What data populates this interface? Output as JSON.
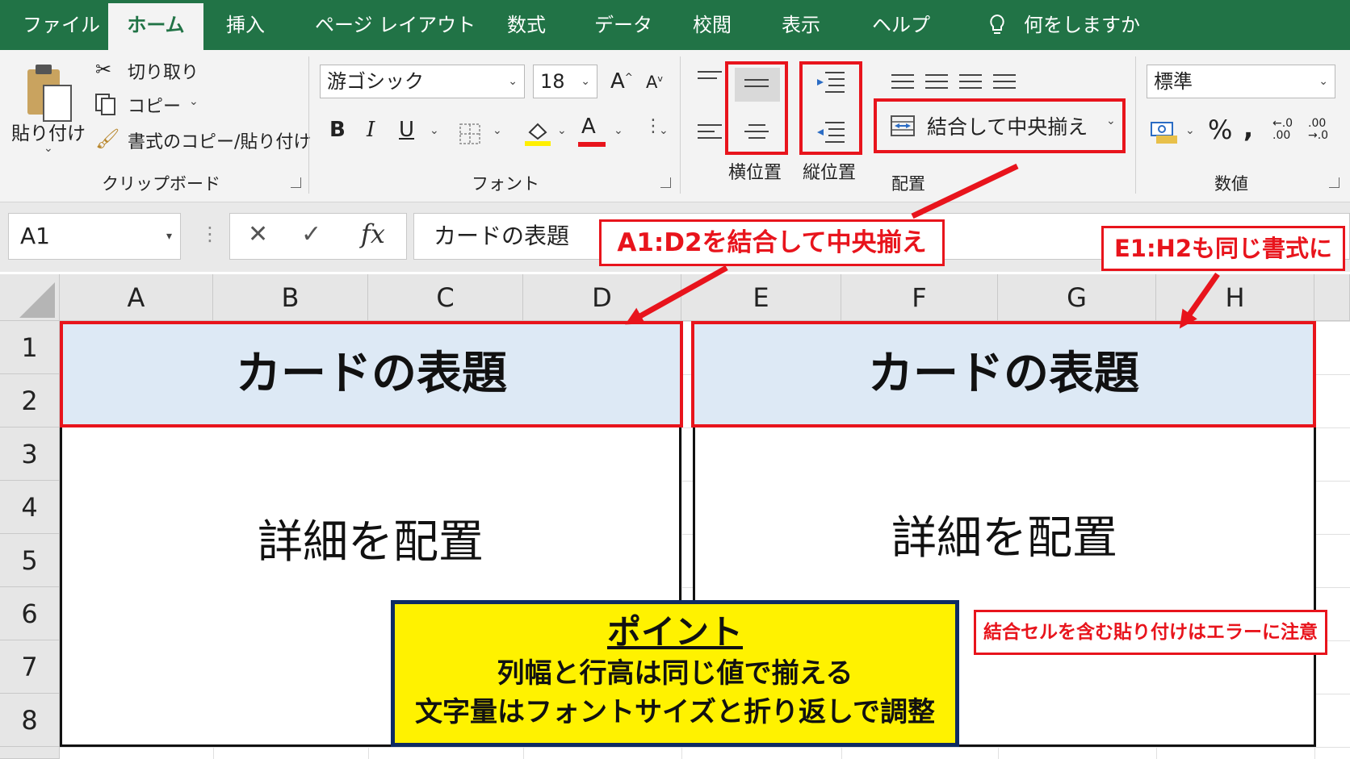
{
  "tabs": [
    "ファイル",
    "ホーム",
    "挿入",
    "ページ レイアウト",
    "数式",
    "データ",
    "校閲",
    "表示",
    "ヘルプ"
  ],
  "tell_me": "何をしますか",
  "clipboard": {
    "paste": "貼り付け",
    "cut": "切り取り",
    "copy": "コピー",
    "format_painter": "書式のコピー/貼り付け",
    "group": "クリップボード"
  },
  "font": {
    "name": "游ゴシック",
    "size": "18",
    "grow_glyph": "A",
    "shrink_glyph": "A",
    "bold": "B",
    "italic": "I",
    "underline": "U",
    "font_color_glyph": "A",
    "group": "フォント"
  },
  "alignment": {
    "horizontal_label": "横位置",
    "vertical_label": "縦位置",
    "merge_center": "結合して中央揃え",
    "group": "配置"
  },
  "number": {
    "format": "標準",
    "percent": "%",
    "comma": ",",
    "inc_decimal": "←.0\n.00",
    "dec_decimal": ".00\n→.0",
    "group": "数値"
  },
  "formula_bar": {
    "name_box": "A1",
    "cancel": "✕",
    "enter": "✓",
    "fx": "fx",
    "value": "カードの表題"
  },
  "columns": [
    "A",
    "B",
    "C",
    "D",
    "E",
    "F",
    "G",
    "H"
  ],
  "rows": [
    "1",
    "2",
    "3",
    "4",
    "5",
    "6",
    "7",
    "8"
  ],
  "cards": [
    {
      "title": "カードの表題",
      "body": "詳細を配置"
    },
    {
      "title": "カードの表題",
      "body": "詳細を配置"
    }
  ],
  "callouts": {
    "merge_a": "A1:D2を結合して中央揃え",
    "merge_e": "E1:H2も同じ書式に",
    "warning": "結合セルを含む貼り付けはエラーに注意"
  },
  "point": {
    "heading": "ポイント",
    "line1": "列幅と行高は同じ値で揃える",
    "line2": "文字量はフォントサイズと折り返しで調整"
  },
  "colors": {
    "excel_green": "#217346",
    "highlight_red": "#e8141c",
    "card_fill": "#dde9f5",
    "point_fill": "#fff200",
    "point_border": "#0e2b63"
  }
}
